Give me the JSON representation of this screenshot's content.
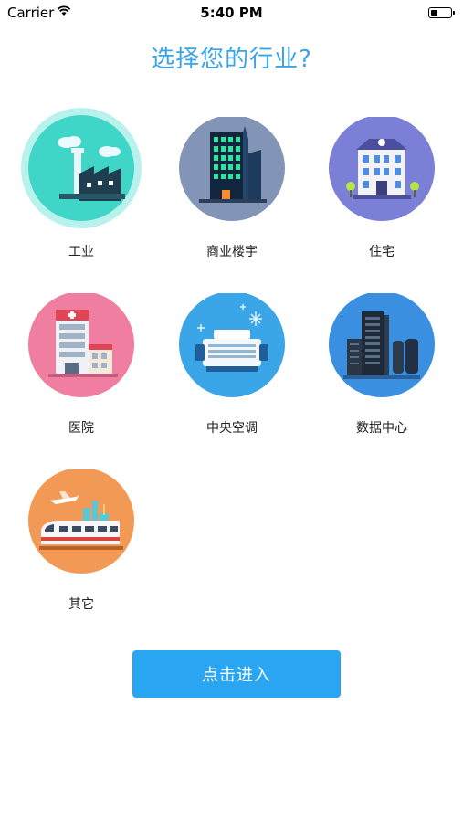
{
  "status_bar": {
    "carrier": "Carrier",
    "time": "5:40 PM"
  },
  "page_title": "选择您的行业?",
  "industries": [
    {
      "label": "工业",
      "icon": "factory-icon",
      "color": "#38d3c6",
      "selected": true
    },
    {
      "label": "商业楼宇",
      "icon": "commercial-building-icon",
      "color": "#7a8fb3",
      "selected": false
    },
    {
      "label": "住宅",
      "icon": "residential-house-icon",
      "color": "#7b7fd4",
      "selected": false
    },
    {
      "label": "医院",
      "icon": "hospital-icon",
      "color": "#f07ea0",
      "selected": false
    },
    {
      "label": "中央空调",
      "icon": "air-conditioner-icon",
      "color": "#3aa6e8",
      "selected": false
    },
    {
      "label": "数据中心",
      "icon": "server-rack-icon",
      "color": "#3a8fe0",
      "selected": false
    },
    {
      "label": "其它",
      "icon": "train-plane-icon",
      "color": "#f29a55",
      "selected": false
    }
  ],
  "enter_button": "点击进入"
}
